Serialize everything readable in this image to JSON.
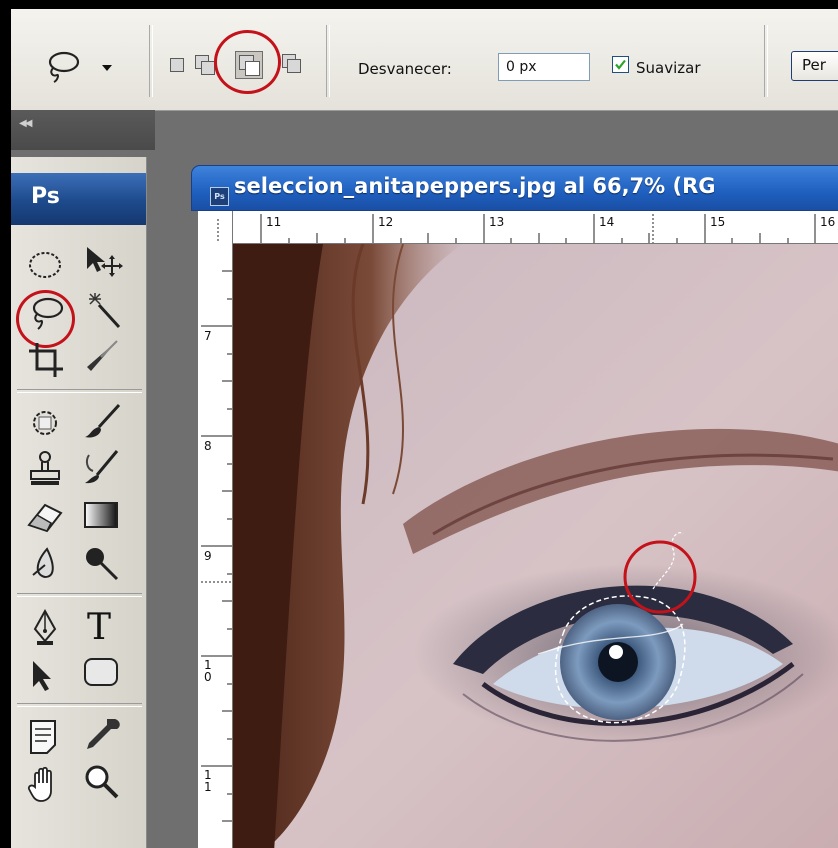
{
  "options_bar": {
    "tool_icon": "lasso-icon",
    "selection_modes": [
      "new-selection-icon",
      "add-to-selection-icon",
      "subtract-from-selection-icon",
      "intersect-selection-icon"
    ],
    "feather_label": "Desvanecer:",
    "feather_value": "0 px",
    "antialias_label": "Suavizar",
    "antialias_checked": true,
    "refine_button_label": "Per"
  },
  "panel": {
    "collapse_icon": "double-chevron-left-icon"
  },
  "toolbox": {
    "logo": "Ps",
    "tools": [
      "elliptical-marquee-icon",
      "move-icon",
      "lasso-icon",
      "magic-wand-icon",
      "crop-icon",
      "slice-icon",
      "healing-brush-icon",
      "brush-icon",
      "clone-stamp-icon",
      "history-brush-icon",
      "eraser-icon",
      "gradient-icon",
      "blur-icon",
      "dodge-icon",
      "pen-icon",
      "type-icon",
      "path-selection-icon",
      "rounded-rectangle-icon",
      "notes-icon",
      "eyedropper-icon",
      "hand-icon",
      "zoom-icon"
    ]
  },
  "document": {
    "logo": "Ps",
    "title": "seleccion_anitapeppers.jpg al 66,7% (RG",
    "ruler_h": [
      "11",
      "12",
      "13",
      "14",
      "15",
      "16"
    ],
    "ruler_v": [
      "7",
      "8",
      "9",
      "1\n0",
      "1\n1"
    ]
  },
  "colors": {
    "highlight_circle": "#c4121a",
    "title_bar": "#1f5fbf",
    "toolbox_logo": "#1e4a8c"
  }
}
